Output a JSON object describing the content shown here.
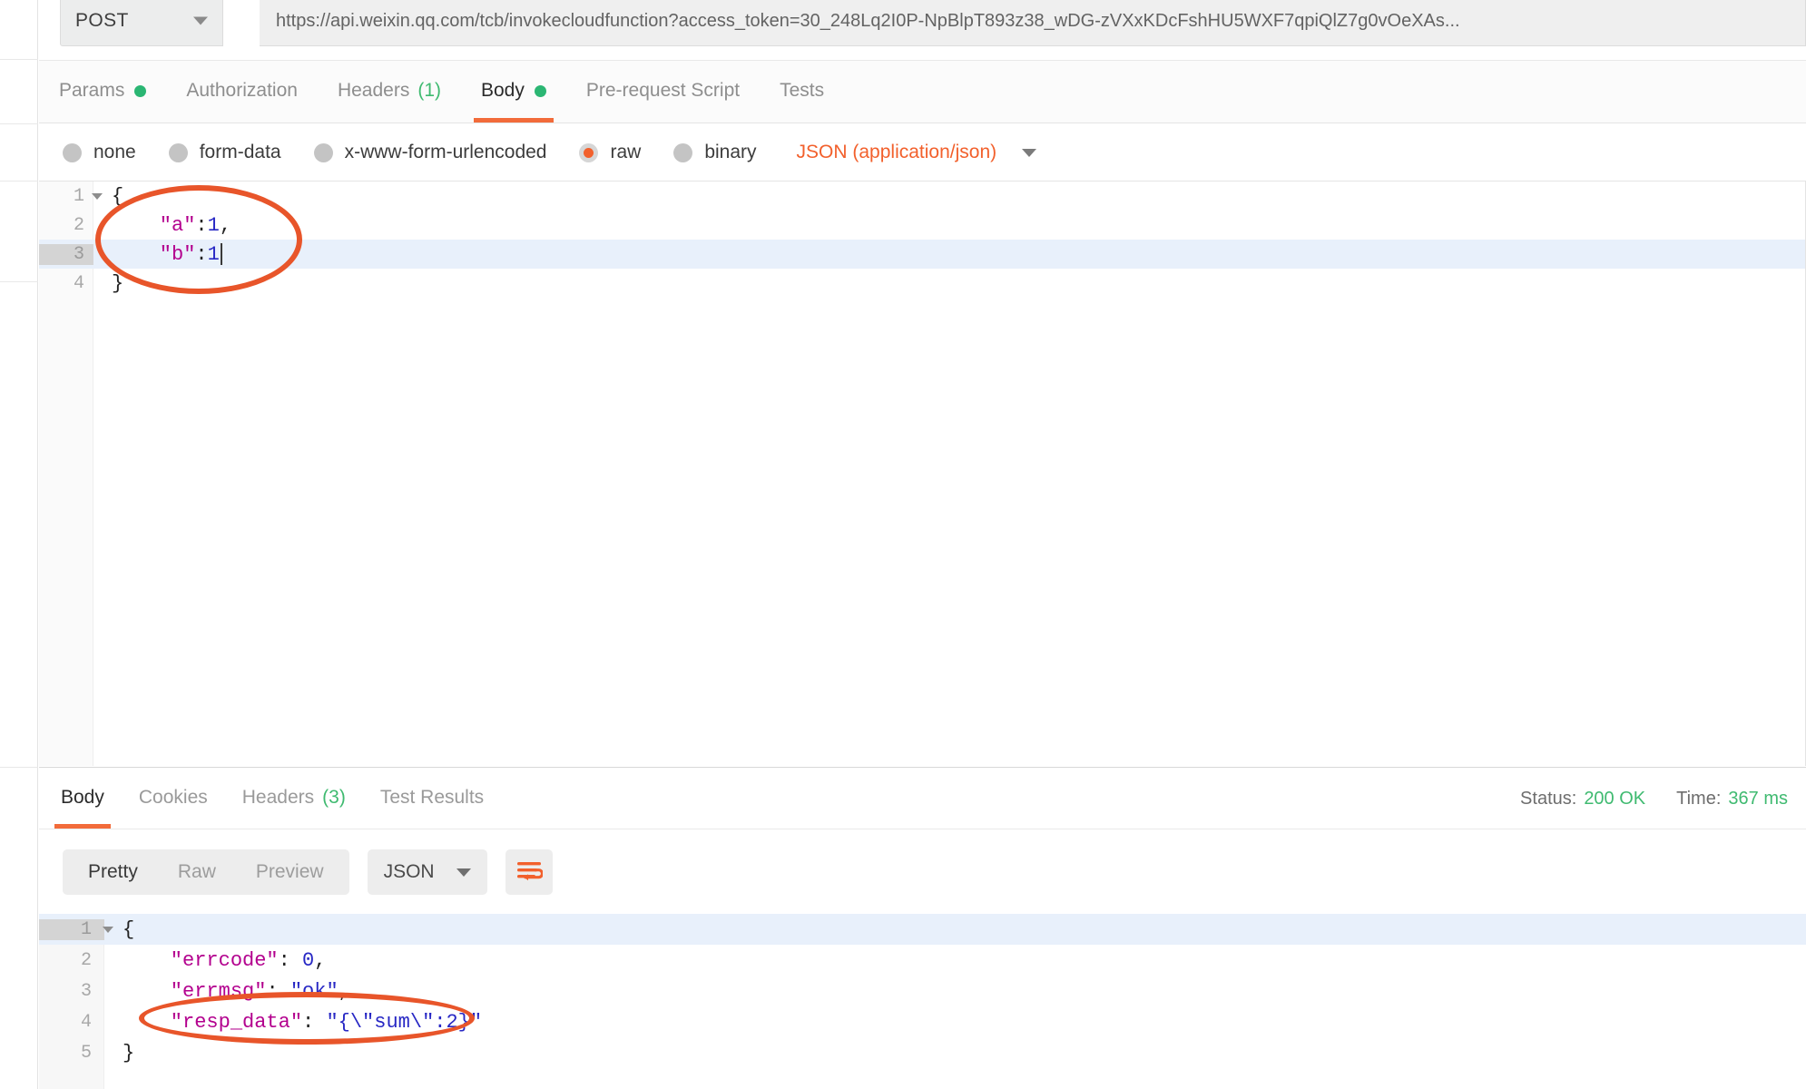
{
  "request": {
    "method": "POST",
    "method_caret_icon": "chevron-down-icon",
    "url": "https://api.weixin.qq.com/tcb/invokecloudfunction?access_token=30_248Lq2I0P-NpBlpT893z38_wDG-zVXxKDcFshHU5WXF7qpiQlZ7g0vOeXAs...",
    "send_label": "",
    "tabs": [
      {
        "label": "Params",
        "indicator": "dot",
        "active": false
      },
      {
        "label": "Authorization",
        "indicator": "",
        "active": false
      },
      {
        "label": "Headers",
        "indicator": "count",
        "count": "(1)",
        "active": false
      },
      {
        "label": "Body",
        "indicator": "dot",
        "active": true
      },
      {
        "label": "Pre-request Script",
        "indicator": "",
        "active": false
      },
      {
        "label": "Tests",
        "indicator": "",
        "active": false
      }
    ],
    "body_types": [
      {
        "label": "none",
        "checked": false
      },
      {
        "label": "form-data",
        "checked": false
      },
      {
        "label": "x-www-form-urlencoded",
        "checked": false
      },
      {
        "label": "raw",
        "checked": true
      },
      {
        "label": "binary",
        "checked": false
      }
    ],
    "content_type": "JSON (application/json)",
    "content_type_caret_icon": "chevron-down-icon",
    "body_lines": [
      {
        "no": "1",
        "fold": true,
        "highlight": false,
        "text": "{"
      },
      {
        "no": "2",
        "fold": false,
        "highlight": false,
        "text": "    \"a\":1,"
      },
      {
        "no": "3",
        "fold": false,
        "highlight": true,
        "text": "    \"b\":1"
      },
      {
        "no": "4",
        "fold": false,
        "highlight": false,
        "text": "}"
      }
    ]
  },
  "response": {
    "tabs": [
      {
        "label": "Body",
        "indicator": "",
        "active": true
      },
      {
        "label": "Cookies",
        "indicator": "",
        "active": false
      },
      {
        "label": "Headers",
        "indicator": "count",
        "count": "(3)",
        "active": false
      },
      {
        "label": "Test Results",
        "indicator": "",
        "active": false
      }
    ],
    "status_label": "Status:",
    "status_value": "200 OK",
    "time_label": "Time:",
    "time_value": "367 ms",
    "view_modes": [
      {
        "label": "Pretty",
        "active": true
      },
      {
        "label": "Raw",
        "active": false
      },
      {
        "label": "Preview",
        "active": false
      }
    ],
    "format": "JSON",
    "format_caret_icon": "chevron-down-icon",
    "wrap_icon": "word-wrap-icon",
    "body_lines": [
      {
        "no": "1",
        "fold": true,
        "highlight": true,
        "text": "{"
      },
      {
        "no": "2",
        "fold": false,
        "highlight": false,
        "text": "    \"errcode\": 0,"
      },
      {
        "no": "3",
        "fold": false,
        "highlight": false,
        "text": "    \"errmsg\": \"ok\","
      },
      {
        "no": "4",
        "fold": false,
        "highlight": false,
        "text": "    \"resp_data\": \"{\\\"sum\\\":2}\""
      },
      {
        "no": "5",
        "fold": false,
        "highlight": false,
        "text": "}"
      }
    ]
  },
  "annotations": [
    {
      "name": "request-body-highlight-ellipse",
      "shape": "ellipse",
      "color": "#e8552a"
    },
    {
      "name": "response-resp-data-ellipse",
      "shape": "ellipse",
      "color": "#e8552a"
    }
  ],
  "colors": {
    "accent_orange": "#f26b3a",
    "annotation_orange": "#e8552a",
    "success_green": "#3fba70",
    "send_blue": "#1a7ff1"
  }
}
